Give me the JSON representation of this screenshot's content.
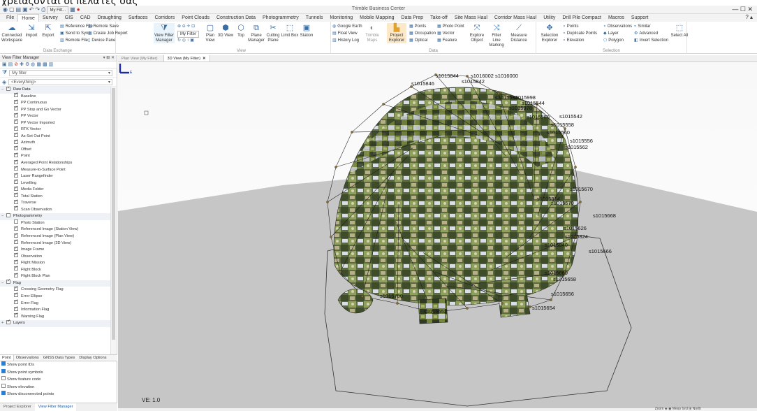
{
  "caption": "χρειάζονται οι πελάτες σας",
  "app": {
    "title": "Trimble Business Center",
    "filter_combo": "My Filt..."
  },
  "window_controls": "—  ☐  ✕",
  "help_label": "? ▴",
  "menu": [
    "File",
    "Home",
    "Survey",
    "GIS",
    "CAD",
    "Draughting",
    "Surfaces",
    "Corridors",
    "Point Clouds",
    "Construction Data",
    "Photogrammetry",
    "Tunnels",
    "Monitoring",
    "Mobile Mapping",
    "Data Prep",
    "Take-off",
    "Site Mass Haul",
    "Corridor Mass Haul",
    "Utility",
    "Drill Pile Compact",
    "Macros",
    "Support"
  ],
  "active_menu": "Home",
  "ribbon": {
    "groups": {
      "data_exchange": "Data Exchange",
      "view": "View",
      "data": "Data",
      "selection": "Selection"
    },
    "connected_workspace": "Connected Workspace",
    "import": "Import",
    "export": "Export",
    "reference_file": "Reference File",
    "send_to_sync": "Send to Sync",
    "remote_file": "Remote File",
    "remote_save": "Remote Save",
    "create_job_report": "Create Job Report",
    "device_pane": "Device Pane",
    "view_filter_manager": "View Filter Manager",
    "my_filter": "My Filter",
    "plan_view": "Plan View",
    "view_3d": "3D View",
    "top": "Top",
    "plane_manager": "Plane Manager",
    "cutting_plane": "Cutting Plane",
    "limit_box": "Limit Box",
    "station": "Station",
    "google_earth": "Google Earth",
    "float_view": "Float View",
    "history_log": "History Log",
    "trimble_maps": "Trimble Maps",
    "project_explorer": "Project Explorer",
    "points": "Points",
    "occupation": "Occupation",
    "optical": "Optical",
    "photo_point": "Photo Point",
    "vector": "Vector",
    "feature": "Feature",
    "explore_object": "Explore Object",
    "filter_line_marking": "Filter Line Marking",
    "measure_distance": "Measure Distance",
    "selection_explorer": "Selection Explorer",
    "sel_points": "Points",
    "duplicate_points": "Duplicate Points",
    "elevation": "Elevation",
    "observations": "Observations",
    "layer": "Layer",
    "polygon": "Polygon",
    "similar": "Similar",
    "advanced": "Advanced",
    "invert_selection": "Invert Selection",
    "select_all": "Select All"
  },
  "panel": {
    "title": "View Filter Manager",
    "pin": "▾ ⊞ ✕",
    "filter_name": "My filter",
    "everything": "<Everything>",
    "tree": [
      {
        "type": "cat",
        "label": "Raw Data",
        "toggle": "−",
        "checked": true
      },
      {
        "type": "leaf",
        "label": "Baseline",
        "checked": true
      },
      {
        "type": "leaf",
        "label": "PP Continuous",
        "checked": true
      },
      {
        "type": "leaf",
        "label": "PP Stop and Go Vector",
        "checked": true
      },
      {
        "type": "leaf",
        "label": "PP Vector",
        "checked": true
      },
      {
        "type": "leaf",
        "label": "PP Vector Imported",
        "checked": true
      },
      {
        "type": "leaf",
        "label": "RTK Vector",
        "checked": true
      },
      {
        "type": "leaf",
        "label": "As-Set Out Point",
        "checked": true
      },
      {
        "type": "leaf",
        "label": "Azimuth",
        "checked": true
      },
      {
        "type": "leaf",
        "label": "Offset",
        "checked": true
      },
      {
        "type": "leaf",
        "label": "Point",
        "checked": true
      },
      {
        "type": "leaf",
        "label": "Averaged Point Relationships",
        "checked": true
      },
      {
        "type": "leaf",
        "label": "Measure-to-Surface Point",
        "checked": true
      },
      {
        "type": "leaf",
        "label": "Laser Rangefinder",
        "checked": true
      },
      {
        "type": "leaf",
        "label": "Levelling",
        "checked": true
      },
      {
        "type": "leaf",
        "label": "Media Folder",
        "checked": true
      },
      {
        "type": "leaf",
        "label": "Total Station",
        "checked": true
      },
      {
        "type": "leaf",
        "label": "Traverse",
        "checked": true
      },
      {
        "type": "leaf",
        "label": "Scan Observation",
        "checked": true
      },
      {
        "type": "cat",
        "label": "Photogrammetry",
        "toggle": "−",
        "checked": false
      },
      {
        "type": "leaf",
        "label": "Photo Station",
        "checked": false
      },
      {
        "type": "leaf",
        "label": "Referenced Image (Station View)",
        "checked": true
      },
      {
        "type": "leaf",
        "label": "Referenced Image (Plan View)",
        "checked": true
      },
      {
        "type": "leaf",
        "label": "Referenced Image (3D View)",
        "checked": true
      },
      {
        "type": "leaf",
        "label": "Image Frame",
        "checked": true
      },
      {
        "type": "leaf",
        "label": "Observation",
        "checked": true
      },
      {
        "type": "leaf",
        "label": "Flight Mission",
        "checked": true
      },
      {
        "type": "leaf",
        "label": "Flight Block",
        "checked": true
      },
      {
        "type": "leaf",
        "label": "Flight Block Plan",
        "checked": true
      },
      {
        "type": "cat",
        "label": "Flag",
        "toggle": "−",
        "checked": true
      },
      {
        "type": "leaf",
        "label": "Crossing Geometry Flag",
        "checked": true
      },
      {
        "type": "leaf",
        "label": "Error Ellipse",
        "checked": true
      },
      {
        "type": "leaf",
        "label": "Error Flag",
        "checked": true
      },
      {
        "type": "leaf",
        "label": "Information Flag",
        "checked": true
      },
      {
        "type": "leaf",
        "label": "Warning Flag",
        "checked": true
      },
      {
        "type": "cat",
        "label": "Layers",
        "toggle": "+",
        "checked": true
      }
    ],
    "option_tabs": [
      "Point",
      "Observations",
      "GNSS Data Types",
      "Display Options"
    ],
    "options": [
      {
        "label": "Show point IDs",
        "checked": true
      },
      {
        "label": "Show point symbols",
        "checked": true
      },
      {
        "label": "Show feature code",
        "checked": false
      },
      {
        "label": "Show elevation",
        "checked": false
      },
      {
        "label": "Show disconnected points",
        "checked": true
      }
    ]
  },
  "bottom_tabs": [
    "Project Explorer",
    "View Filter Manager"
  ],
  "doc_tabs": [
    {
      "label": "Plan View (My Filter)",
      "active": false,
      "close": ""
    },
    {
      "label": "3D View (My Filter)",
      "active": true,
      "close": "✕"
    }
  ],
  "viewport": {
    "ve": "VE: 1.0",
    "axis_label": "E",
    "point_labels": [
      "s1015844",
      "s1016002 s1016000",
      "s1015846",
      "s1015842",
      "s1015538",
      "s1015998",
      "s1015544",
      "s1015978",
      "s1015580",
      "s1015542",
      "s1015558",
      "s1015556",
      "s1015560",
      "s1015562",
      "s1015670",
      "s1015914",
      "s1015570",
      "s1015626",
      "s1015668",
      "s1015824",
      "s1015840",
      "s1015666",
      "s1015680",
      "s1015658",
      "s1015656",
      "s1015654",
      "s1015652",
      "s1015700"
    ]
  },
  "status": "Zoom  ◈ ◉  Meas  Grd  ⊞ North"
}
